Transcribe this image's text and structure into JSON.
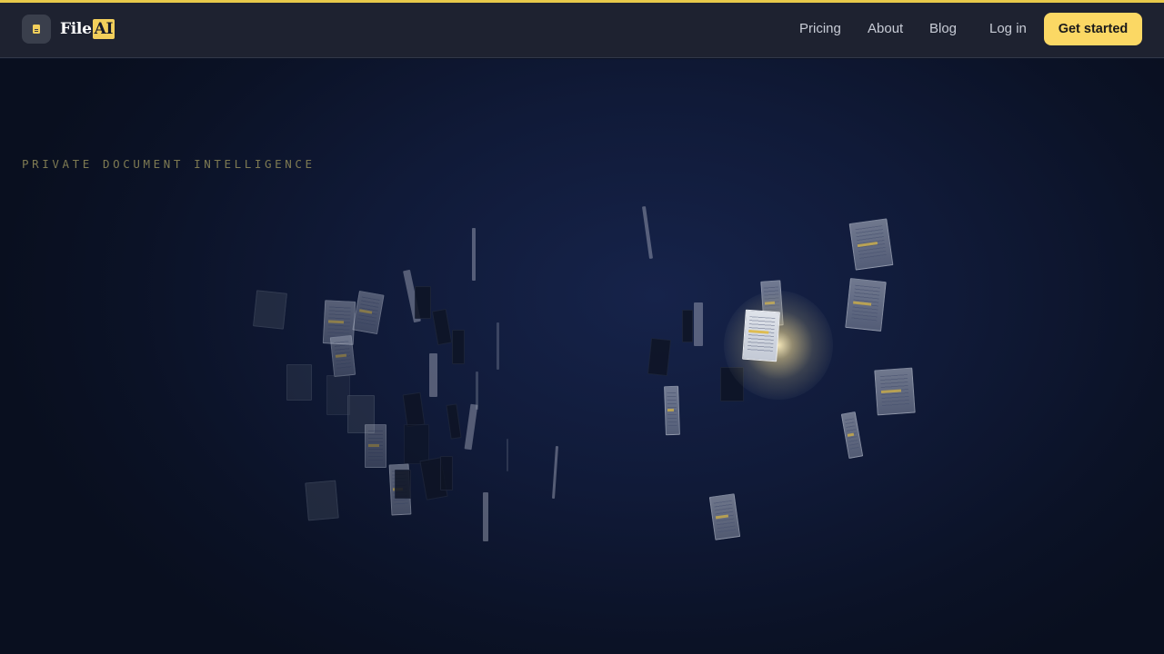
{
  "header": {
    "brand_prefix": "File",
    "brand_highlight": "AI",
    "logo_icon": "document-icon",
    "nav": {
      "pricing": "Pricing",
      "about": "About",
      "blog": "Blog",
      "login": "Log in"
    },
    "cta_label": "Get started"
  },
  "hero": {
    "eyebrow": "PRIVATE DOCUMENT INTELLIGENCE"
  },
  "colors": {
    "accent": "#fbd864",
    "background": "#0c1426",
    "navbar": "#1e2230"
  }
}
